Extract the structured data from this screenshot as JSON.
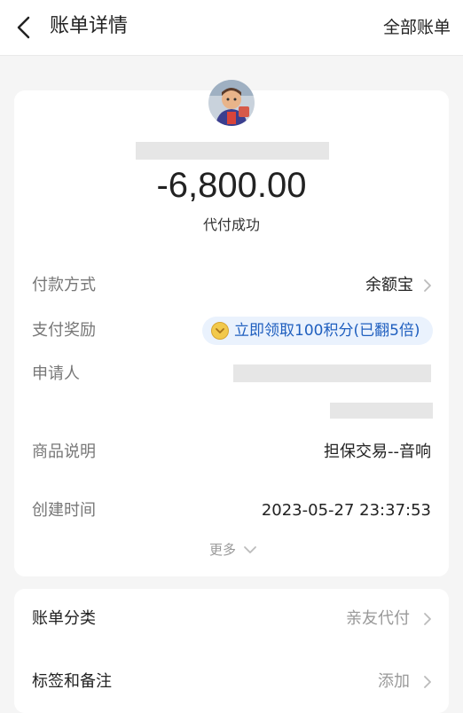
{
  "header": {
    "title": "账单详情",
    "right_link": "全部账单"
  },
  "summary": {
    "amount": "-6,800.00",
    "status": "代付成功"
  },
  "details": [
    {
      "label": "付款方式",
      "value": "余额宝"
    },
    {
      "label": "支付奖励",
      "value": "立即领取100积分(已翻5倍)"
    },
    {
      "label": "申请人",
      "value": ""
    },
    {
      "label": "商品说明",
      "value": "担保交易--音响"
    },
    {
      "label": "创建时间",
      "value": "2023-05-27 23:37:53"
    }
  ],
  "more_label": "更多",
  "extras": [
    {
      "label": "账单分类",
      "value": "亲友代付"
    },
    {
      "label": "标签和备注",
      "value": "添加"
    }
  ],
  "colors": {
    "page_bg": "#f5f5f5",
    "card_bg": "#ffffff",
    "link_blue": "#1f5fbf",
    "reward_bg": "#eaf2fd"
  }
}
